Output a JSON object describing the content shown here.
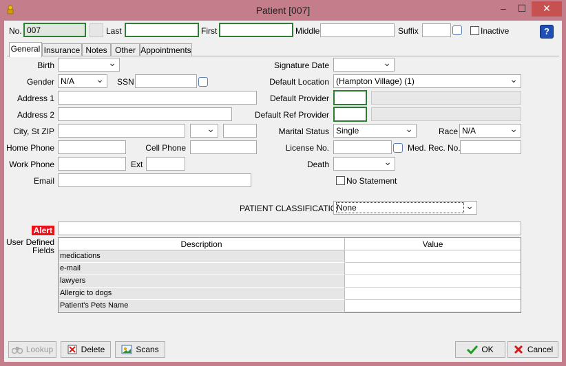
{
  "window": {
    "title": "Patient [007]",
    "controls": {
      "minimize": "–",
      "maximize": "☐",
      "close": "✕"
    }
  },
  "header": {
    "no_label": "No.",
    "no_value": "007",
    "last_label": "Last",
    "last_value": "",
    "first_label": "First",
    "first_value": "",
    "middle_label": "Middle",
    "middle_value": "",
    "suffix_label": "Suffix",
    "suffix_value": "",
    "inactive_label": "Inactive",
    "help_icon": "?"
  },
  "tabs": [
    {
      "label": "General",
      "active": true
    },
    {
      "label": "Insurance"
    },
    {
      "label": "Notes"
    },
    {
      "label": "Other"
    },
    {
      "label": "Appointments"
    }
  ],
  "general": {
    "birth_label": "Birth",
    "gender_label": "Gender",
    "gender_value": "N/A",
    "ssn_label": "SSN",
    "address1_label": "Address 1",
    "address2_label": "Address 2",
    "city_label": "City, St  ZIP",
    "home_phone_label": "Home Phone",
    "cell_phone_label": "Cell Phone",
    "work_phone_label": "Work Phone",
    "ext_label": "Ext",
    "email_label": "Email",
    "signature_date_label": "Signature Date",
    "default_location_label": "Default Location",
    "default_location_value": "(Hampton Village) (1)",
    "default_provider_label": "Default Provider",
    "default_ref_provider_label": "Default Ref Provider",
    "marital_status_label": "Marital Status",
    "marital_status_value": "Single",
    "race_label": "Race",
    "race_value": "N/A",
    "license_label": "License No.",
    "med_rec_label": "Med. Rec. No.",
    "death_label": "Death",
    "no_statement_label": "No Statement",
    "classification_label": "PATIENT CLASSIFICATION",
    "classification_value": "None",
    "alert_label": "Alert",
    "udf_label_1": "User Defined",
    "udf_label_2": "Fields"
  },
  "udf_grid": {
    "columns": [
      "Description",
      "Value"
    ],
    "rows": [
      {
        "description": "medications",
        "value": ""
      },
      {
        "description": "e-mail",
        "value": ""
      },
      {
        "description": "lawyers",
        "value": ""
      },
      {
        "description": "Allergic to dogs",
        "value": ""
      },
      {
        "description": "Patient's Pets Name",
        "value": ""
      }
    ]
  },
  "buttons": {
    "lookup": "Lookup",
    "delete": "Delete",
    "scans": "Scans",
    "ok": "OK",
    "cancel": "Cancel"
  },
  "colors": {
    "title_bar": "#c47d8a",
    "required_border": "#2e7d32",
    "alert": "#e8141c",
    "close_button": "#c75050"
  }
}
